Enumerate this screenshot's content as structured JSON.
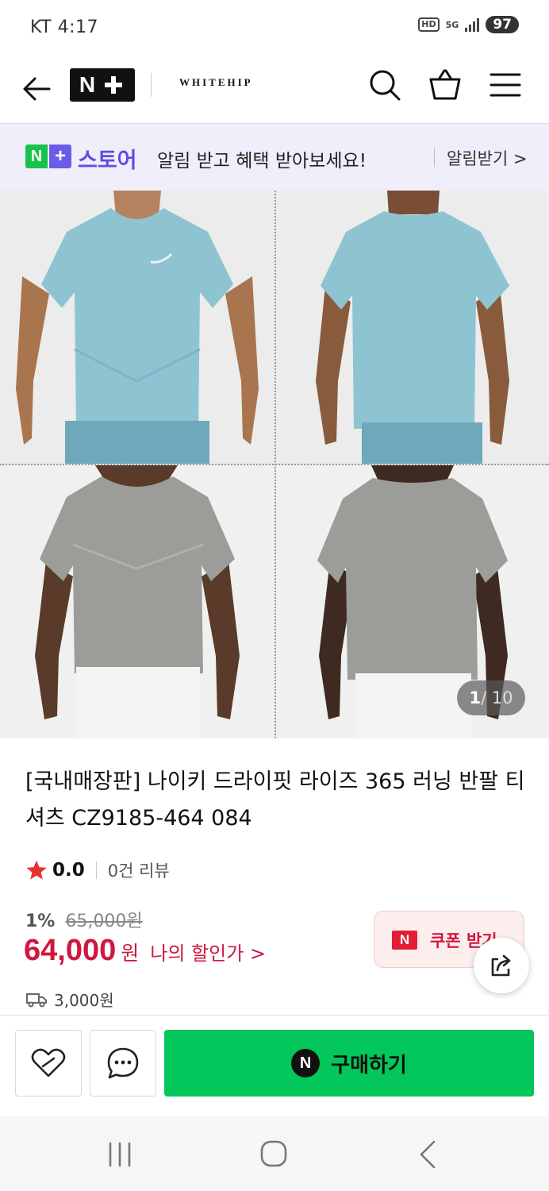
{
  "status_bar": {
    "carrier_time": "KT 4:17",
    "hd": "HD",
    "net": "5G",
    "battery": "97"
  },
  "header": {
    "brand": "WHITEHIP",
    "icons": [
      "back-arrow-icon",
      "search-icon",
      "shopping-bag-icon",
      "menu-icon"
    ]
  },
  "promo": {
    "store_label": "스토어",
    "message": "알림 받고 혜택 받아보세요!",
    "link": "알림받기 >"
  },
  "gallery": {
    "current": "1",
    "total": "/ 10",
    "colors": {
      "blue": "#8ec3d2",
      "gray": "#9c9c98"
    }
  },
  "product": {
    "title": "[국내매장판] 나이키 드라이핏 라이즈 365 러닝 반팔 티셔츠 CZ9185-464 084",
    "rating": "0.0",
    "reviews": "0건 리뷰",
    "discount_rate": "1%",
    "original_price": "65,000원",
    "price": "64,000",
    "currency": "원",
    "my_discount": "나의 할인가 >",
    "coupon": "쿠폰 받기",
    "shipping": "3,000원"
  },
  "buy_bar": {
    "buy_label": "구매하기"
  },
  "colors": {
    "accent_green": "#03c75a",
    "price_red": "#d0173d",
    "promo_purple": "#5d4fe0"
  }
}
